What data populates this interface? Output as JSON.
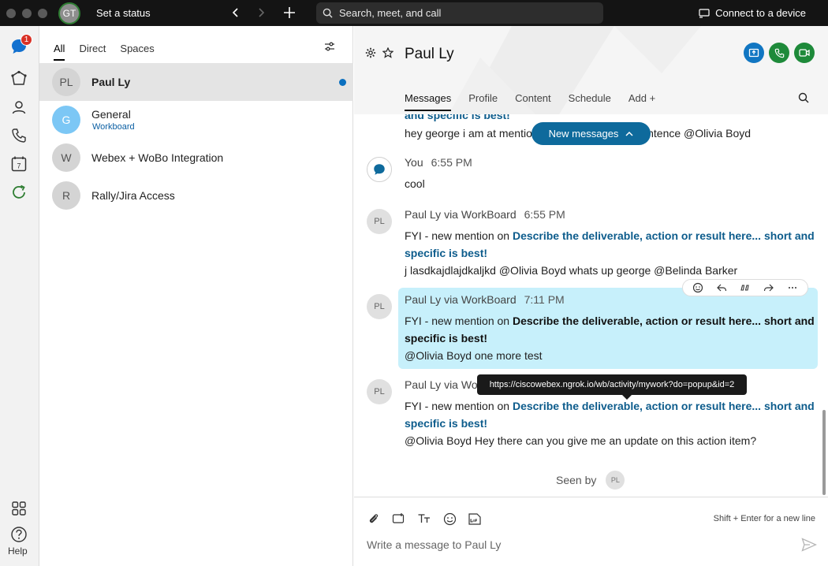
{
  "titlebar": {
    "avatar_initials": "GT",
    "status_label": "Set a status",
    "search_placeholder": "Search, meet, and call",
    "connect_label": "Connect to a device"
  },
  "rail": {
    "badge_count": "1",
    "help_label": "Help",
    "calendar_day": "7"
  },
  "list": {
    "tabs": [
      {
        "label": "All",
        "active": true
      },
      {
        "label": "Direct",
        "active": false
      },
      {
        "label": "Spaces",
        "active": false
      }
    ],
    "conversations": [
      {
        "initials": "PL",
        "name": "Paul Ly",
        "sub": "",
        "selected": true,
        "unread": true
      },
      {
        "initials": "G",
        "name": "General",
        "sub": "Workboard",
        "selected": false,
        "unread": false
      },
      {
        "initials": "W",
        "name": "Webex + WoBo Integration",
        "sub": "",
        "selected": false,
        "unread": false
      },
      {
        "initials": "R",
        "name": "Rally/Jira Access",
        "sub": "",
        "selected": false,
        "unread": false
      }
    ]
  },
  "main": {
    "title": "Paul Ly",
    "tabs": [
      "Messages",
      "Profile",
      "Content",
      "Schedule",
      "Add"
    ],
    "new_messages_label": "New messages",
    "messages": {
      "m0_link_tail": "and specific is best!",
      "m0_text_a": "hey george i am at mentio",
      "m0_text_b": "he sentence @Olivia Boyd",
      "m1_sender": "You",
      "m1_time": "6:55 PM",
      "m1_text": "cool",
      "m2_sender": "Paul Ly via WorkBoard",
      "m2_time": "6:55 PM",
      "m2_prefix": "FYI - new mention on ",
      "m2_link": "Describe the deliverable, action or result here... short and specific is best!",
      "m2_body": "j lasdkajdlajdkaljkd @Olivia Boyd whats up george @Belinda Barker",
      "m3_sender": "Paul Ly via WorkBoard",
      "m3_time": "7:11 PM",
      "m3_prefix": "FYI - new mention on ",
      "m3_link": "Describe the deliverable, action or result here... short and specific is best!",
      "m3_body": "@Olivia Boyd one more test",
      "m4_sender": "Paul Ly via Wo",
      "m4_prefix": "FYI - new mention on ",
      "m4_link": "Describe the deliverable, action or result here... short and specific is best!",
      "m4_body": "@Olivia Boyd Hey there can you give me an update on this action item?"
    },
    "avatar_initials": "PL",
    "tooltip": "https://ciscowebex.ngrok.io/wb/activity/mywork?do=popup&id=2",
    "seen_by_label": "Seen by",
    "seen_by_initials": "PL"
  },
  "composer": {
    "hint": "Shift + Enter for a new line",
    "placeholder": "Write a message to Paul Ly"
  }
}
